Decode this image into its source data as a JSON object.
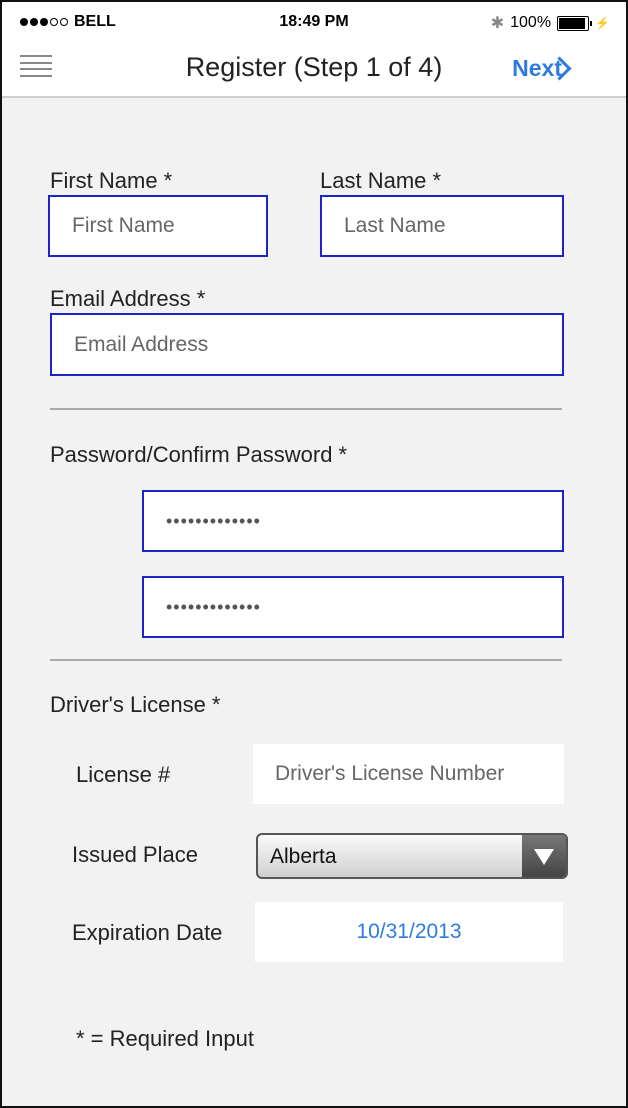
{
  "status": {
    "carrier": "BELL",
    "time": "18:49 PM",
    "battery": "100%"
  },
  "nav": {
    "title": "Register (Step 1 of 4)",
    "next": "Next"
  },
  "form": {
    "first_name_label": "First Name *",
    "first_name_placeholder": "First Name",
    "last_name_label": "Last Name *",
    "last_name_placeholder": "Last Name",
    "email_label": "Email Address *",
    "email_placeholder": "Email Address",
    "password_label": "Password/Confirm Password *",
    "password_value": "•••••••••••••",
    "confirm_value": "•••••••••••••",
    "license_section": "Driver's License *",
    "license_label": "License #",
    "license_placeholder": "Driver's License Number",
    "issued_label": "Issued Place",
    "issued_value": "Alberta",
    "expiration_label": "Expiration Date",
    "expiration_value": "10/31/2013",
    "required_note": "* = Required Input"
  },
  "colors": {
    "accent": "#2d7be0",
    "input_border": "#1d23c9"
  }
}
